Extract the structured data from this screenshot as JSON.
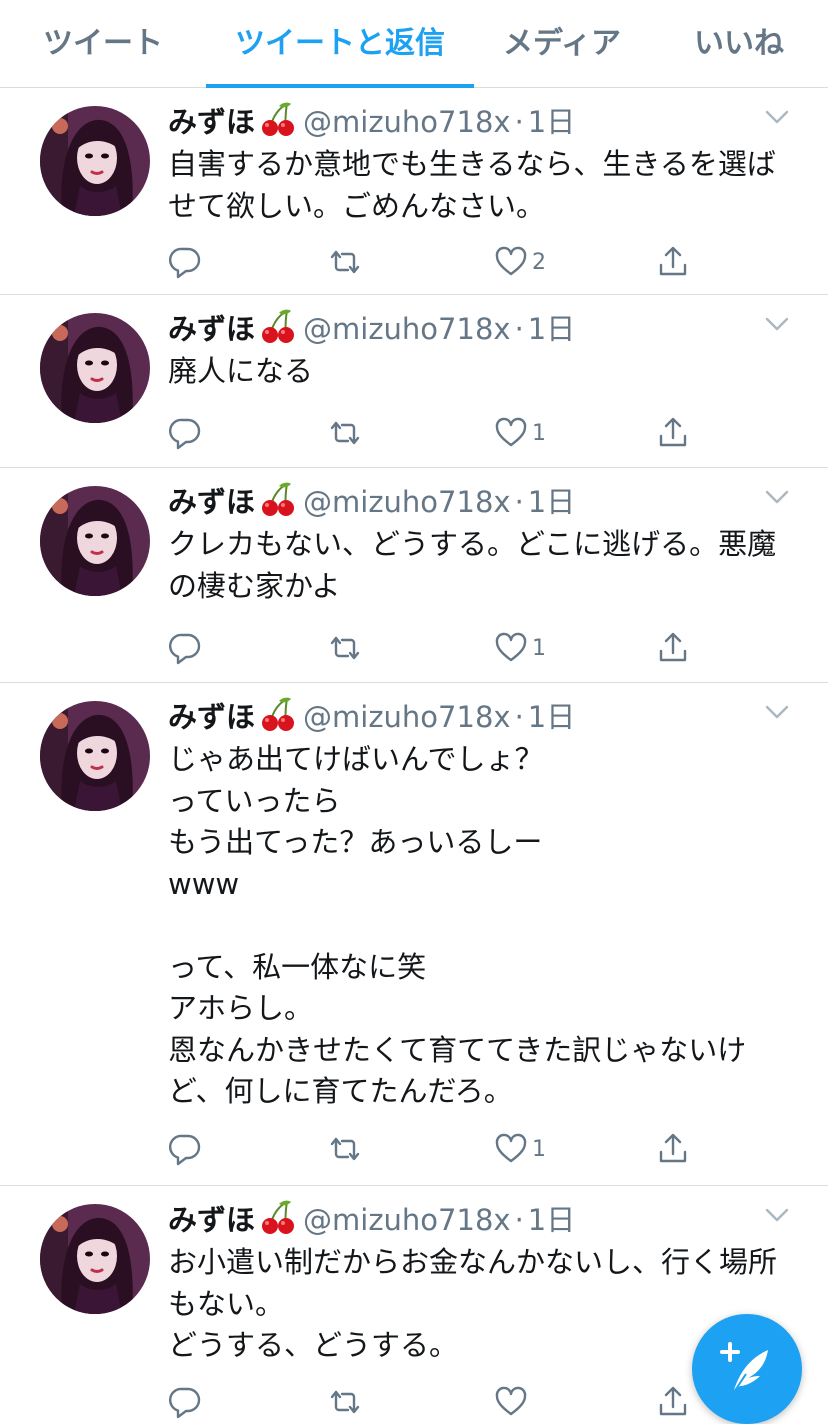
{
  "tabs": [
    {
      "label": "ツイート"
    },
    {
      "label": "ツイートと返信"
    },
    {
      "label": "メディア"
    },
    {
      "label": "いいね"
    }
  ],
  "user": {
    "name": "みずほ",
    "handle": "@mizuho718x",
    "name_emoji": "cherries-emoji"
  },
  "tweets": [
    {
      "time": "1日",
      "text": "自害するか意地でも生きるなら、生きるを選ばせて欲しい。ごめんなさい。",
      "likes": "2"
    },
    {
      "time": "1日",
      "text": "廃人になる",
      "likes": "1"
    },
    {
      "time": "1日",
      "text": "クレカもない、どうする。どこに逃げる。悪魔の棲む家かよ",
      "likes": "1"
    },
    {
      "time": "1日",
      "text": "じゃあ出てけばいんでしょ？\nっていったら\nもう出てった？あっいるしー\nwww\n\nって、私一体なに笑\nアホらし。\n恩なんかきせたくて育ててきた訳じゃないけど、何しに育てたんだろ。",
      "likes": "1"
    },
    {
      "time": "1日",
      "text": "お小遣い制だからお金なんかないし、行く場所もない。\nどうする、どうする。",
      "likes": ""
    }
  ],
  "colors": {
    "accent": "#1da1f2",
    "secondary_text": "#657786",
    "divider": "#d8dde1"
  },
  "icons": {
    "reply": "reply-icon",
    "retweet": "retweet-icon",
    "like": "heart-icon",
    "share": "share-icon",
    "menu": "chevron-down-icon",
    "compose": "compose-tweet-icon"
  }
}
